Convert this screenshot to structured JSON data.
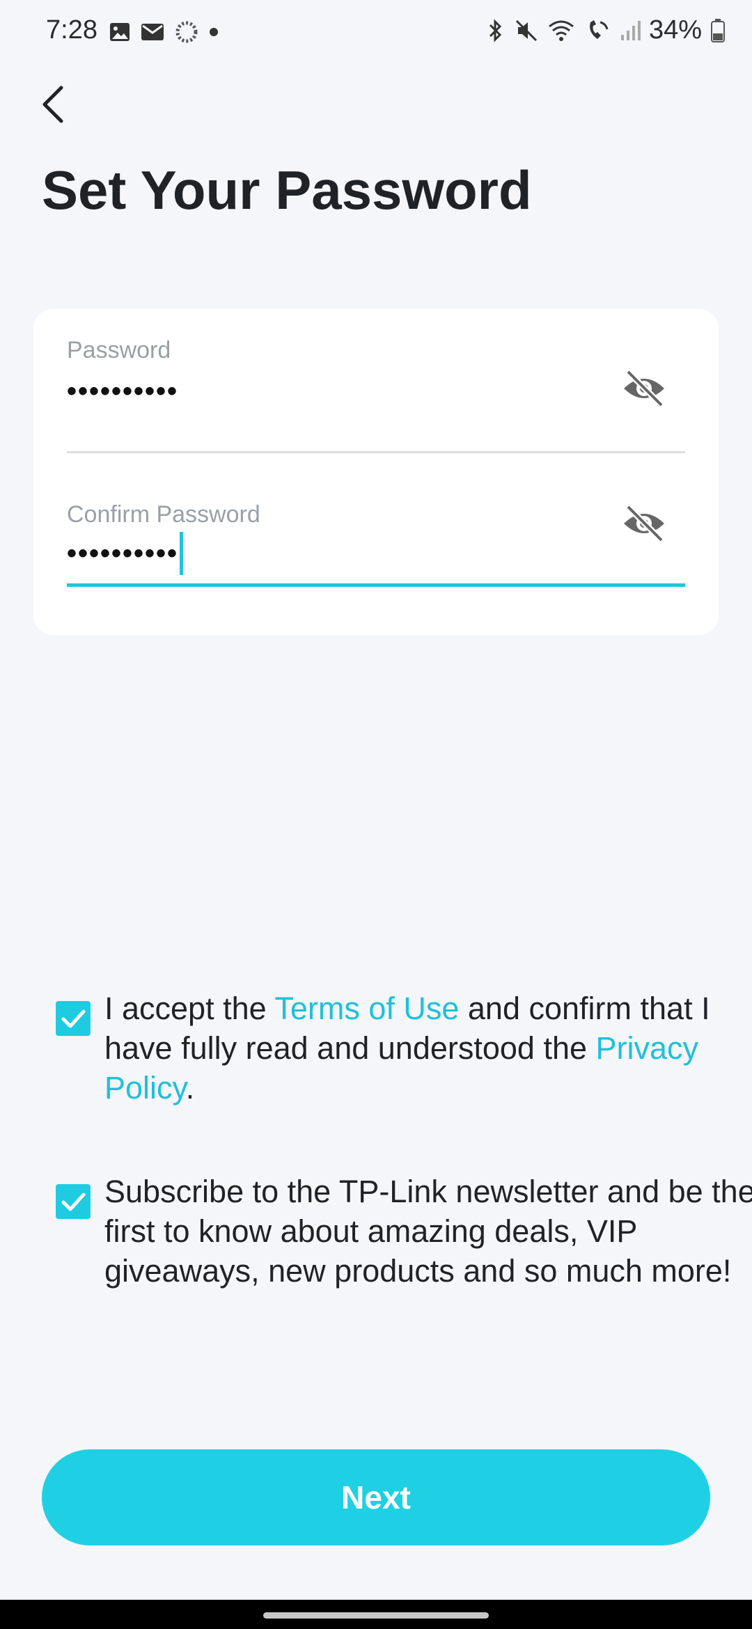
{
  "status_bar": {
    "time": "7:28",
    "battery_text": "34%",
    "left_icons": [
      "gallery-icon",
      "mail-icon",
      "sync-icon",
      "dot-icon"
    ],
    "right_icons": [
      "bluetooth-icon",
      "mute-icon",
      "wifi-icon",
      "wifi-call-icon",
      "signal-icon",
      "battery-icon"
    ]
  },
  "header": {
    "title": "Set Your Password"
  },
  "form": {
    "password": {
      "label": "Password",
      "value": "••••••••••"
    },
    "confirm_password": {
      "label": "Confirm Password",
      "value": "••••••••••"
    }
  },
  "consents": {
    "terms": {
      "checked": true,
      "text_before": "I accept the ",
      "terms_link": "Terms of Use",
      "text_middle": " and confirm that I have fully read and understood the ",
      "privacy_link": "Privacy Policy",
      "text_after": "."
    },
    "newsletter": {
      "checked": true,
      "text": "Subscribe to the TP-Link newsletter and be the first to know about amazing deals, VIP giveaways, new products and so much more!"
    }
  },
  "actions": {
    "next_label": "Next"
  },
  "colors": {
    "accent": "#1fd0e4",
    "link": "#1fc0d8",
    "background": "#f4f6fa",
    "card": "#ffffff"
  }
}
